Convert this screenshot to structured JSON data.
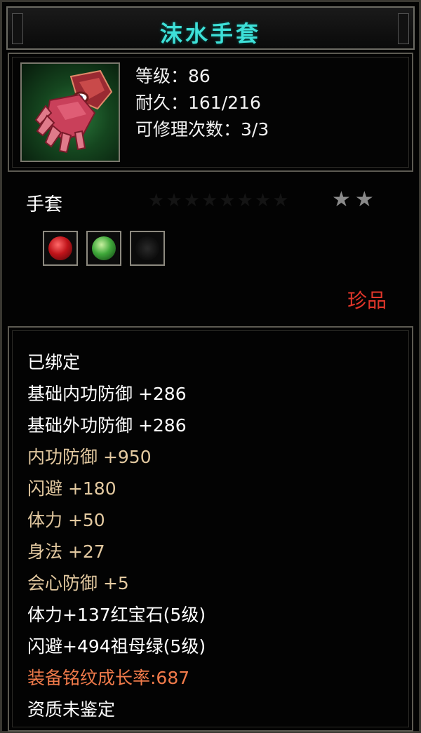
{
  "title": "沫水手套",
  "info": {
    "level": "等级：86",
    "durability": "耐久：161/216",
    "repairs": "可修理次数：3/3"
  },
  "item_type": "手套",
  "stars": {
    "dim_count": 8,
    "lit_count": 2
  },
  "gems": [
    {
      "name": "ruby-gem",
      "color": "#c0141a"
    },
    {
      "name": "emerald-gem",
      "color": "#3fa83a"
    },
    {
      "name": "empty-slot",
      "color": "#1a1a1a"
    }
  ],
  "rarity": "珍品",
  "stats": [
    {
      "text": "已绑定",
      "tone": "white"
    },
    {
      "text": "基础内功防御  +286",
      "tone": "white"
    },
    {
      "text": "基础外功防御  +286",
      "tone": "white"
    },
    {
      "text": "内功防御  +950",
      "tone": "gold"
    },
    {
      "text": "闪避  +180",
      "tone": "gold"
    },
    {
      "text": "体力  +50",
      "tone": "gold"
    },
    {
      "text": "身法  +27",
      "tone": "gold"
    },
    {
      "text": "会心防御  +5",
      "tone": "gold"
    },
    {
      "text": "体力+137红宝石(5级)",
      "tone": "white"
    },
    {
      "text": "闪避+494祖母绿(5级)",
      "tone": "white"
    },
    {
      "text": "装备铭纹成长率:687",
      "tone": "orange"
    },
    {
      "text": "资质未鉴定",
      "tone": "white"
    }
  ],
  "colors": {
    "title": "#3ee0d8",
    "rarity": "#e0362a",
    "stat_gold": "#e3c9a0",
    "stat_orange": "#f07a4a"
  }
}
